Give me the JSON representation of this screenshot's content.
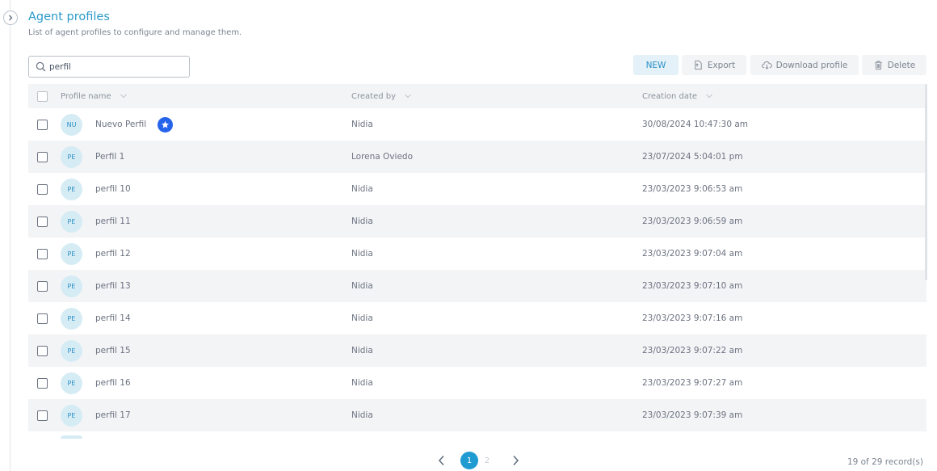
{
  "page": {
    "title": "Agent profiles",
    "subtitle": "List of agent profiles to configure and manage them."
  },
  "search": {
    "value": "perfil"
  },
  "toolbar": {
    "new_label": "NEW",
    "export_label": "Export",
    "download_label": "Download profile",
    "delete_label": "Delete"
  },
  "table": {
    "columns": [
      "Profile name",
      "Created by",
      "Creation date"
    ],
    "rows": [
      {
        "initials": "NU",
        "name": "Nuevo Perfil",
        "created_by": "Nidia",
        "date": "30/08/2024 10:47:30 am",
        "starred": true
      },
      {
        "initials": "PE",
        "name": "Perfil 1",
        "created_by": "Lorena Oviedo",
        "date": "23/07/2024 5:04:01 pm"
      },
      {
        "initials": "PE",
        "name": "perfil 10",
        "created_by": "Nidia",
        "date": "23/03/2023 9:06:53 am"
      },
      {
        "initials": "PE",
        "name": "perfil 11",
        "created_by": "Nidia",
        "date": "23/03/2023 9:06:59 am"
      },
      {
        "initials": "PE",
        "name": "perfil 12",
        "created_by": "Nidia",
        "date": "23/03/2023 9:07:04 am"
      },
      {
        "initials": "PE",
        "name": "perfil 13",
        "created_by": "Nidia",
        "date": "23/03/2023 9:07:10 am"
      },
      {
        "initials": "PE",
        "name": "perfil 14",
        "created_by": "Nidia",
        "date": "23/03/2023 9:07:16 am"
      },
      {
        "initials": "PE",
        "name": "perfil 15",
        "created_by": "Nidia",
        "date": "23/03/2023 9:07:22 am"
      },
      {
        "initials": "PE",
        "name": "perfil 16",
        "created_by": "Nidia",
        "date": "23/03/2023 9:07:27 am"
      },
      {
        "initials": "PE",
        "name": "perfil 17",
        "created_by": "Nidia",
        "date": "23/03/2023 9:07:39 am"
      }
    ]
  },
  "pagination": {
    "pages": [
      "1",
      "2"
    ],
    "current": "1",
    "records": "19 of 29 record(s)"
  },
  "icons": {
    "collapse": "chevron-right-icon",
    "search": "search-icon",
    "export": "export-icon",
    "download": "cloud-download-icon",
    "delete": "trash-icon",
    "sort": "chevron-down-icon",
    "star": "star-icon"
  },
  "colors": {
    "accent": "#2b9ac9",
    "star_badge": "#2563eb",
    "pager_active": "#1f9bd1",
    "row_alt": "#f3f4f6"
  }
}
